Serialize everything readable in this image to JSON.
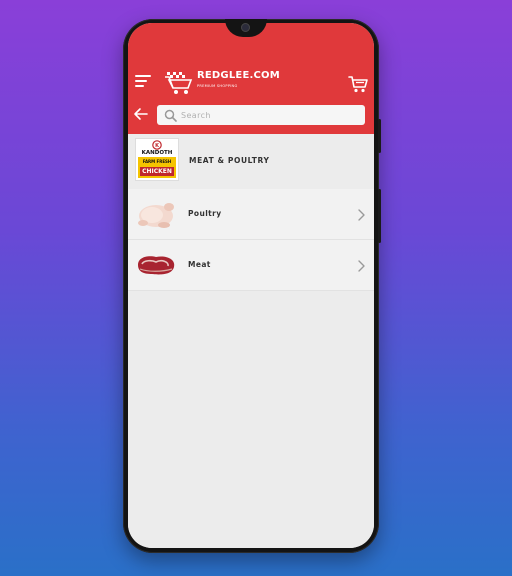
{
  "header": {
    "logo_title": "REDGLEE.COM",
    "logo_tagline": "PREMIUM SHOPPING"
  },
  "search": {
    "placeholder": "Search",
    "value": ""
  },
  "category": {
    "title": "MEAT & POULTRY",
    "brand_lines": [
      "KANDOTH",
      "FARM FRESH",
      "CHICKEN"
    ]
  },
  "items": [
    {
      "label": "Poultry",
      "icon": "chicken-thumbnail"
    },
    {
      "label": "Meat",
      "icon": "steak-thumbnail"
    }
  ],
  "colors": {
    "accent": "#e0393b",
    "background_top": "#8a3fd8",
    "background_bottom": "#2a70c8"
  }
}
